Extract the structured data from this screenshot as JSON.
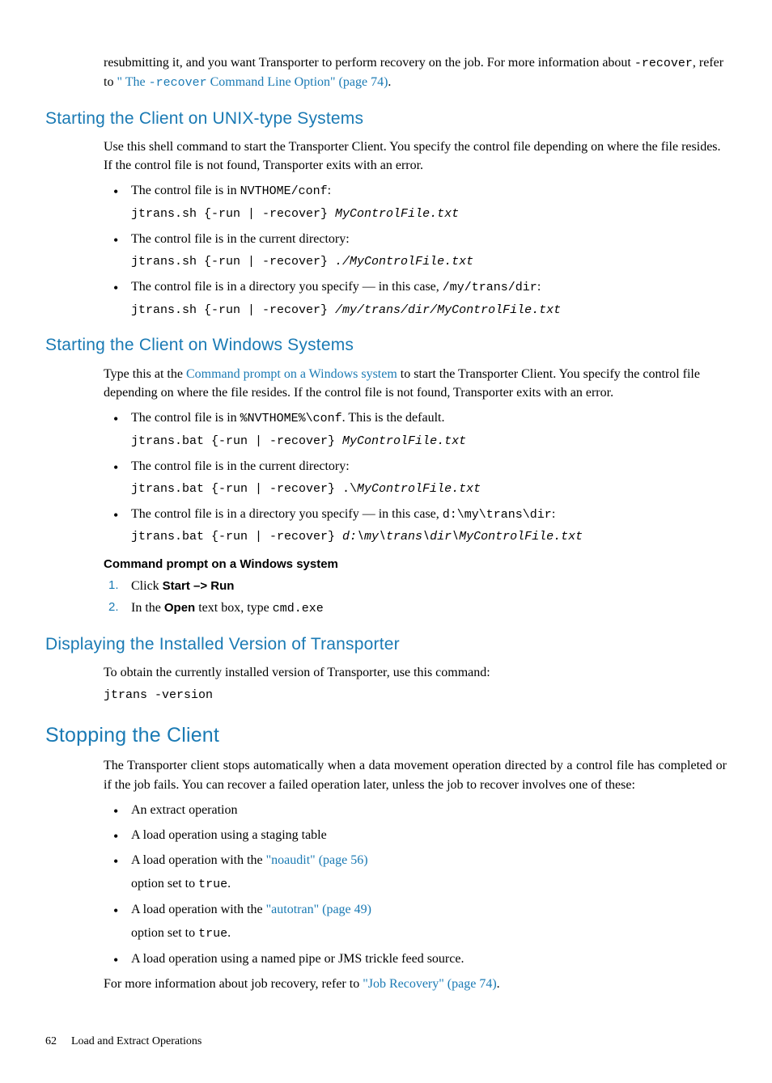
{
  "intro": {
    "p1a": "resubmitting it, and you want Transporter to perform recovery on the job. For more information about ",
    "p1_code": "-recover",
    "p1b": ", refer to ",
    "p1_link_a": "\" The ",
    "p1_link_code": "-recover",
    "p1_link_b": " Command Line Option\" (page 74)",
    "p1_end": "."
  },
  "unix": {
    "heading": "Starting the Client on UNIX-type Systems",
    "p1": "Use this shell command to start the Transporter Client. You specify the control file depending on where the file resides. If the control file is not found, Transporter exits with an error.",
    "li1a": "The control file is in ",
    "li1_code": "NVTHOME/conf",
    "li1b": ":",
    "li1_cmd_a": "jtrans.sh {-run | -recover} ",
    "li1_cmd_b": "MyControlFile.txt",
    "li2": "The control file is in the current directory:",
    "li2_cmd_a": "jtrans.sh {-run | -recover} ",
    "li2_cmd_b": "./MyControlFile.txt",
    "li3a": "The control file is in a directory you specify — in this case, ",
    "li3_code": "/my/trans/dir",
    "li3b": ":",
    "li3_cmd_a": "jtrans.sh {-run | -recover} ",
    "li3_cmd_b": "/my/trans/dir/MyControlFile.txt"
  },
  "win": {
    "heading": "Starting the Client on Windows Systems",
    "p1a": "Type this at the ",
    "p1_link": "Command prompt on a Windows system",
    "p1b": " to start the Transporter Client. You specify the control file depending on where the file resides. If the control file is not found, Transporter exits with an error.",
    "li1a": "The control file is in ",
    "li1_code": "%NVTHOME%\\conf",
    "li1b": ". This is the default.",
    "li1_cmd_a": "jtrans.bat {-run | -recover} ",
    "li1_cmd_b": "MyControlFile.txt",
    "li2": "The control file is in the current directory:",
    "li2_cmd_a": "jtrans.bat {-run | -recover} .\\",
    "li2_cmd_b": "MyControlFile.txt",
    "li3a": "The control file is in a directory you specify — in this case, ",
    "li3_code": "d:\\my\\trans\\dir",
    "li3b": ":",
    "li3_cmd_a": "jtrans.bat {-run | -recover} ",
    "li3_cmd_b": "d:\\my\\trans\\dir\\MyControlFile.txt",
    "cmd_heading": "Command prompt on a Windows system",
    "step1a": "Click ",
    "step1b": "Start –> Run",
    "step2a": "In the ",
    "step2b": "Open",
    "step2c": " text box, type ",
    "step2_code": "cmd.exe"
  },
  "version": {
    "heading": "Displaying the Installed Version of Transporter",
    "p1": "To obtain the currently installed version of Transporter, use this command:",
    "cmd": "jtrans -version"
  },
  "stop": {
    "heading": "Stopping the Client",
    "p1": "The Transporter client stops automatically when a data movement operation directed by a control file has completed or if the job fails. You can recover a failed operation later, unless the job to recover involves one of these:",
    "li1": "An extract operation",
    "li2": "A load operation using a staging table",
    "li3a": "A load operation with the ",
    "li3_link": "\"noaudit\" (page 56)",
    "li3b": "option set to ",
    "li3_code": "true",
    "li3c": ".",
    "li4a": "A load operation with the ",
    "li4_link": "\"autotran\" (page 49)",
    "li4b": "option set to ",
    "li4_code": "true",
    "li4c": ".",
    "li5": "A load operation using a named pipe or JMS trickle feed source.",
    "p2a": "For more information about job recovery, refer to ",
    "p2_link": "\"Job Recovery\" (page 74)",
    "p2b": "."
  },
  "footer": {
    "page": "62",
    "chapter": "Load and Extract Operations"
  }
}
